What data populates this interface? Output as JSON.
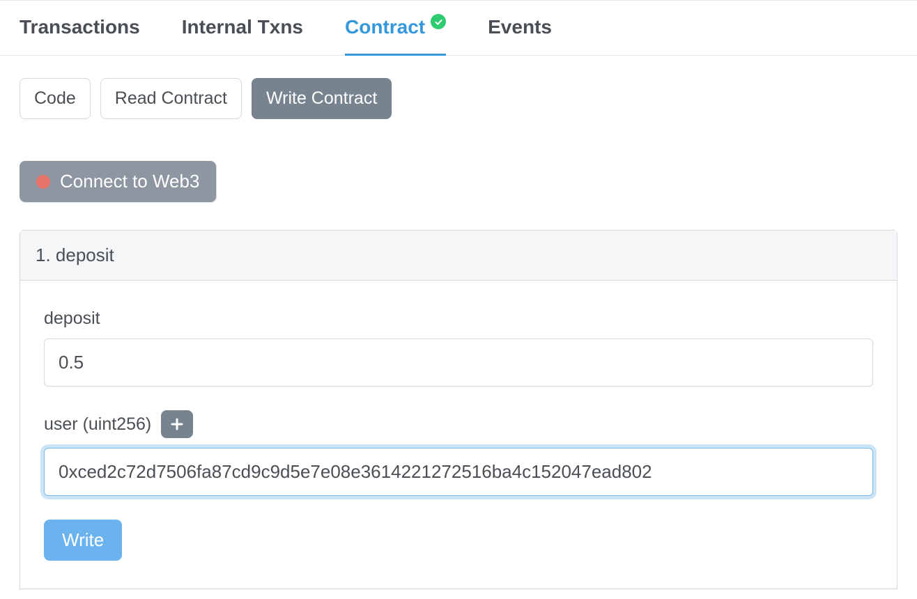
{
  "tabs": {
    "transactions": "Transactions",
    "internal_txns": "Internal Txns",
    "contract": "Contract",
    "events": "Events"
  },
  "subtabs": {
    "code": "Code",
    "read_contract": "Read Contract",
    "write_contract": "Write Contract"
  },
  "connect": {
    "label": "Connect to Web3"
  },
  "func": {
    "header": "1. deposit",
    "deposit_label": "deposit",
    "deposit_value": "0.5",
    "user_label": "user (uint256)",
    "user_value": "0xced2c72d7506fa87cd9c9d5e7e08e3614221272516ba4c152047ead802",
    "write_label": "Write"
  }
}
